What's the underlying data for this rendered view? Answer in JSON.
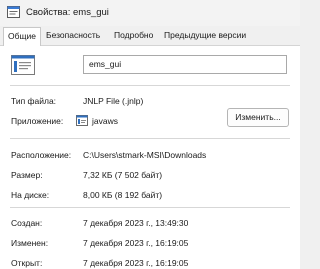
{
  "window": {
    "title": "Свойства: ems_gui"
  },
  "tabs": [
    {
      "label": "Общие",
      "active": true
    },
    {
      "label": "Безопасность",
      "active": false
    },
    {
      "label": "Подробно",
      "active": false
    },
    {
      "label": "Предыдущие версии",
      "active": false
    }
  ],
  "general": {
    "file_name": "ems_gui",
    "file_type_label": "Тип файла:",
    "file_type_value": "JNLP File (.jnlp)",
    "app_label": "Приложение:",
    "app_value": "javaws",
    "change_button": "Изменить...",
    "location_label": "Расположение:",
    "location_value": "C:\\Users\\stmark-MSI\\Downloads",
    "size_label": "Размер:",
    "size_value": "7,32 КБ (7 502 байт)",
    "disk_label": "На диске:",
    "disk_value": "8,00 КБ (8 192 байт)",
    "created_label": "Создан:",
    "created_value": "7 декабря 2023 г., 13:49:30",
    "modified_label": "Изменен:",
    "modified_value": "7 декабря 2023 г., 16:19:05",
    "opened_label": "Открыт:",
    "opened_value": "7 декабря 2023 г., 16:19:05"
  },
  "icons": {
    "title": "properties-icon",
    "file": "jnlp-file-icon",
    "app": "javaws-app-icon"
  },
  "colors": {
    "window_bg": "#f0f0f0",
    "panel_bg": "#ffffff",
    "accent": "#2f6fbf"
  }
}
